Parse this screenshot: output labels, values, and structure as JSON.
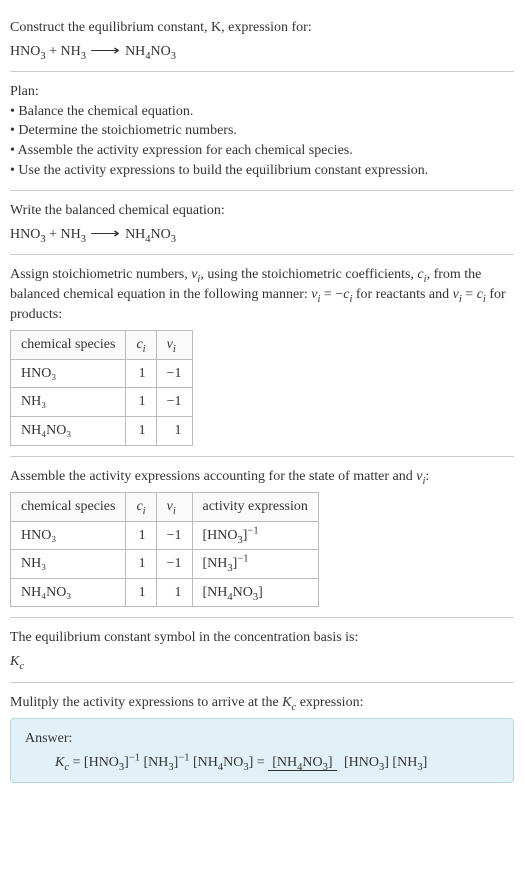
{
  "header": {
    "prompt_line1": "Construct the equilibrium constant, K, expression for:",
    "equation_lhs_1": "HNO",
    "equation_lhs_1_sub": "3",
    "equation_plus": " + ",
    "equation_lhs_2": "NH",
    "equation_lhs_2_sub": "3",
    "equation_rhs": "NH",
    "equation_rhs_sub1": "4",
    "equation_rhs_mid": "NO",
    "equation_rhs_sub2": "3"
  },
  "plan": {
    "title": "Plan:",
    "b1": "• Balance the chemical equation.",
    "b2": "• Determine the stoichiometric numbers.",
    "b3": "• Assemble the activity expression for each chemical species.",
    "b4": "• Use the activity expressions to build the equilibrium constant expression."
  },
  "balanced": {
    "title": "Write the balanced chemical equation:"
  },
  "stoich": {
    "intro_a": "Assign stoichiometric numbers, ",
    "nu_i": "ν",
    "sub_i": "i",
    "intro_b": ", using the stoichiometric coefficients, ",
    "c_i": "c",
    "intro_c": ", from the balanced chemical equation in the following manner: ",
    "rel1_a": " = −",
    "rel1_b": " for reactants and ",
    "rel2_a": " = ",
    "rel2_b": " for products:",
    "col1": "chemical species",
    "col2c": "c",
    "col2i": "i",
    "col3n": "ν",
    "col3i": "i",
    "r1s": "HNO₃",
    "r1c": "1",
    "r1n": "−1",
    "r2s": "NH₃",
    "r2c": "1",
    "r2n": "−1",
    "r3s": "NH₄NO₃",
    "r3c": "1",
    "r3n": "1"
  },
  "activity": {
    "title_a": "Assemble the activity expressions accounting for the state of matter and ",
    "title_b": ":",
    "col4": "activity expression",
    "r1a_open": "[HNO",
    "r1a_sub": "3",
    "r1a_close": "]",
    "r1a_exp": "−1",
    "r2a_open": "[NH",
    "r2a_sub": "3",
    "r2a_close": "]",
    "r2a_exp": "−1",
    "r3a_open": "[NH",
    "r3a_sub1": "4",
    "r3a_mid": "NO",
    "r3a_sub2": "3",
    "r3a_close": "]"
  },
  "symbol": {
    "line1": "The equilibrium constant symbol in the concentration basis is:",
    "K": "K",
    "c": "c"
  },
  "multiply": {
    "line_a": "Mulitply the activity expressions to arrive at the ",
    "line_b": " expression:"
  },
  "answer": {
    "label": "Answer:",
    "eq_eq": " = ",
    "frac_top_open": "[NH",
    "frac_top_sub1": "4",
    "frac_top_mid": "NO",
    "frac_top_sub2": "3",
    "frac_top_close": "]",
    "frac_bot_1_open": "[HNO",
    "frac_bot_1_sub": "3",
    "frac_bot_1_close": "]",
    "frac_bot_sp": " ",
    "frac_bot_2_open": "[NH",
    "frac_bot_2_sub": "3",
    "frac_bot_2_close": "]"
  }
}
